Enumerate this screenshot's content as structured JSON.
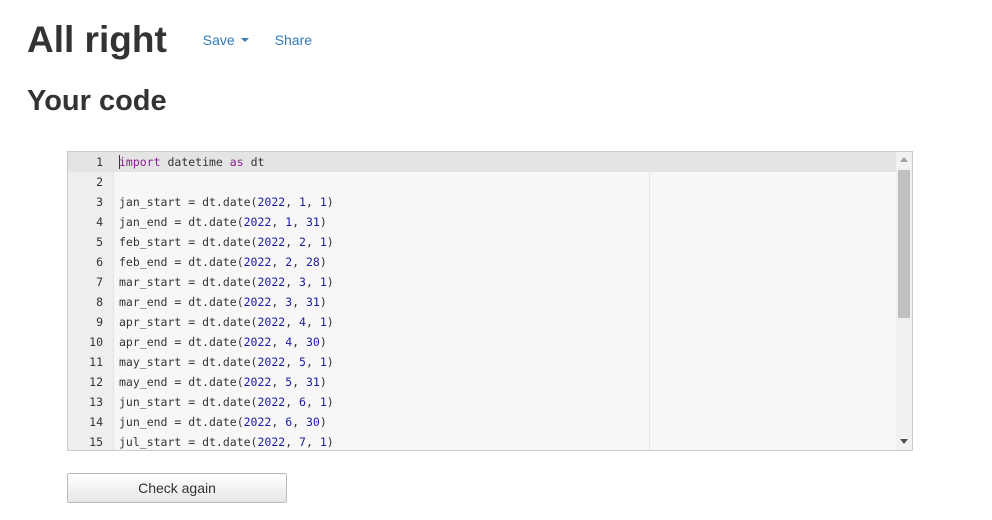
{
  "header": {
    "title": "All right",
    "save_label": "Save",
    "share_label": "Share"
  },
  "section": {
    "subtitle": "Your code"
  },
  "editor": {
    "lines": [
      {
        "num": "1",
        "tokens": [
          {
            "t": "import",
            "c": "kw"
          },
          {
            "t": " datetime ",
            "c": ""
          },
          {
            "t": "as",
            "c": "kw"
          },
          {
            "t": " dt",
            "c": ""
          }
        ]
      },
      {
        "num": "2",
        "tokens": []
      },
      {
        "num": "3",
        "tokens": [
          {
            "t": "jan_start = dt.date(",
            "c": ""
          },
          {
            "t": "2022",
            "c": "num"
          },
          {
            "t": ", ",
            "c": ""
          },
          {
            "t": "1",
            "c": "num"
          },
          {
            "t": ", ",
            "c": ""
          },
          {
            "t": "1",
            "c": "num"
          },
          {
            "t": ")",
            "c": ""
          }
        ]
      },
      {
        "num": "4",
        "tokens": [
          {
            "t": "jan_end = dt.date(",
            "c": ""
          },
          {
            "t": "2022",
            "c": "num"
          },
          {
            "t": ", ",
            "c": ""
          },
          {
            "t": "1",
            "c": "num"
          },
          {
            "t": ", ",
            "c": ""
          },
          {
            "t": "31",
            "c": "num"
          },
          {
            "t": ")",
            "c": ""
          }
        ]
      },
      {
        "num": "5",
        "tokens": [
          {
            "t": "feb_start = dt.date(",
            "c": ""
          },
          {
            "t": "2022",
            "c": "num"
          },
          {
            "t": ", ",
            "c": ""
          },
          {
            "t": "2",
            "c": "num"
          },
          {
            "t": ", ",
            "c": ""
          },
          {
            "t": "1",
            "c": "num"
          },
          {
            "t": ")",
            "c": ""
          }
        ]
      },
      {
        "num": "6",
        "tokens": [
          {
            "t": "feb_end = dt.date(",
            "c": ""
          },
          {
            "t": "2022",
            "c": "num"
          },
          {
            "t": ", ",
            "c": ""
          },
          {
            "t": "2",
            "c": "num"
          },
          {
            "t": ", ",
            "c": ""
          },
          {
            "t": "28",
            "c": "num"
          },
          {
            "t": ")",
            "c": ""
          }
        ]
      },
      {
        "num": "7",
        "tokens": [
          {
            "t": "mar_start = dt.date(",
            "c": ""
          },
          {
            "t": "2022",
            "c": "num"
          },
          {
            "t": ", ",
            "c": ""
          },
          {
            "t": "3",
            "c": "num"
          },
          {
            "t": ", ",
            "c": ""
          },
          {
            "t": "1",
            "c": "num"
          },
          {
            "t": ")",
            "c": ""
          }
        ]
      },
      {
        "num": "8",
        "tokens": [
          {
            "t": "mar_end = dt.date(",
            "c": ""
          },
          {
            "t": "2022",
            "c": "num"
          },
          {
            "t": ", ",
            "c": ""
          },
          {
            "t": "3",
            "c": "num"
          },
          {
            "t": ", ",
            "c": ""
          },
          {
            "t": "31",
            "c": "num"
          },
          {
            "t": ")",
            "c": ""
          }
        ]
      },
      {
        "num": "9",
        "tokens": [
          {
            "t": "apr_start = dt.date(",
            "c": ""
          },
          {
            "t": "2022",
            "c": "num"
          },
          {
            "t": ", ",
            "c": ""
          },
          {
            "t": "4",
            "c": "num"
          },
          {
            "t": ", ",
            "c": ""
          },
          {
            "t": "1",
            "c": "num"
          },
          {
            "t": ")",
            "c": ""
          }
        ]
      },
      {
        "num": "10",
        "tokens": [
          {
            "t": "apr_end = dt.date(",
            "c": ""
          },
          {
            "t": "2022",
            "c": "num"
          },
          {
            "t": ", ",
            "c": ""
          },
          {
            "t": "4",
            "c": "num"
          },
          {
            "t": ", ",
            "c": ""
          },
          {
            "t": "30",
            "c": "num"
          },
          {
            "t": ")",
            "c": ""
          }
        ]
      },
      {
        "num": "11",
        "tokens": [
          {
            "t": "may_start = dt.date(",
            "c": ""
          },
          {
            "t": "2022",
            "c": "num"
          },
          {
            "t": ", ",
            "c": ""
          },
          {
            "t": "5",
            "c": "num"
          },
          {
            "t": ", ",
            "c": ""
          },
          {
            "t": "1",
            "c": "num"
          },
          {
            "t": ")",
            "c": ""
          }
        ]
      },
      {
        "num": "12",
        "tokens": [
          {
            "t": "may_end = dt.date(",
            "c": ""
          },
          {
            "t": "2022",
            "c": "num"
          },
          {
            "t": ", ",
            "c": ""
          },
          {
            "t": "5",
            "c": "num"
          },
          {
            "t": ", ",
            "c": ""
          },
          {
            "t": "31",
            "c": "num"
          },
          {
            "t": ")",
            "c": ""
          }
        ]
      },
      {
        "num": "13",
        "tokens": [
          {
            "t": "jun_start = dt.date(",
            "c": ""
          },
          {
            "t": "2022",
            "c": "num"
          },
          {
            "t": ", ",
            "c": ""
          },
          {
            "t": "6",
            "c": "num"
          },
          {
            "t": ", ",
            "c": ""
          },
          {
            "t": "1",
            "c": "num"
          },
          {
            "t": ")",
            "c": ""
          }
        ]
      },
      {
        "num": "14",
        "tokens": [
          {
            "t": "jun_end = dt.date(",
            "c": ""
          },
          {
            "t": "2022",
            "c": "num"
          },
          {
            "t": ", ",
            "c": ""
          },
          {
            "t": "6",
            "c": "num"
          },
          {
            "t": ", ",
            "c": ""
          },
          {
            "t": "30",
            "c": "num"
          },
          {
            "t": ")",
            "c": ""
          }
        ]
      },
      {
        "num": "15",
        "tokens": [
          {
            "t": "jul_start = dt.date(",
            "c": ""
          },
          {
            "t": "2022",
            "c": "num"
          },
          {
            "t": ", ",
            "c": ""
          },
          {
            "t": "7",
            "c": "num"
          },
          {
            "t": ", ",
            "c": ""
          },
          {
            "t": "1",
            "c": "num"
          },
          {
            "t": ")",
            "c": ""
          }
        ]
      }
    ]
  },
  "actions": {
    "check_again_label": "Check again"
  },
  "colors": {
    "link": "#337ab7",
    "keyword": "#8b1f8c",
    "number": "#1a1aa6",
    "active_line": "#e4e4e4",
    "gutter": "#eeeeee"
  }
}
